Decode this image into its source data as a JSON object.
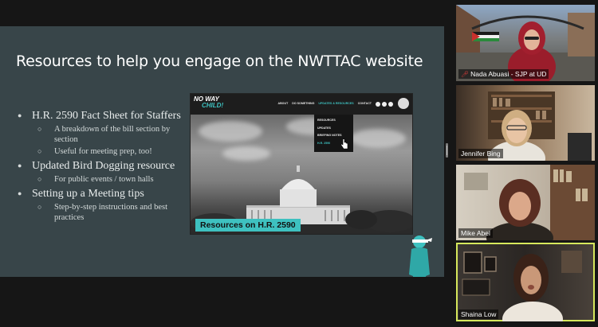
{
  "slide": {
    "title": "Resources to help you engage on the NWTTAC website",
    "bullets": [
      {
        "text": "H.R. 2590 Fact Sheet for Staffers",
        "subs": [
          "A breakdown of the bill section by section",
          "Useful for meeting prep, too!"
        ]
      },
      {
        "text": "Updated Bird Dogging resource",
        "subs": [
          "For public events / town halls"
        ]
      },
      {
        "text": "Setting up a Meeting tips",
        "subs": [
          "Step-by-step instructions and best practices"
        ]
      }
    ]
  },
  "website": {
    "logo_line1": "NO WAY",
    "logo_line2": "CHILD!",
    "nav": [
      "ABOUT",
      "DO SOMETHING",
      "UPDATES & RESOURCES",
      "CONTACT"
    ],
    "dropdown": [
      "RESOURCES",
      "UPDATES",
      "BRIEFING NOTES",
      "H.R. 2590"
    ],
    "banner": "Resources on H.R. 2590"
  },
  "participants": [
    {
      "name": "Nada Abuasi - SJP at UD",
      "muted": true
    },
    {
      "name": "Jennifer Bing",
      "muted": false
    },
    {
      "name": "Mike Abel",
      "muted": false
    },
    {
      "name": "Shaina Low",
      "muted": false,
      "speaking": true
    }
  ],
  "colors": {
    "accent": "#3ec1c0",
    "slide_bg": "#384549",
    "speaker_outline": "#d6e85c"
  }
}
